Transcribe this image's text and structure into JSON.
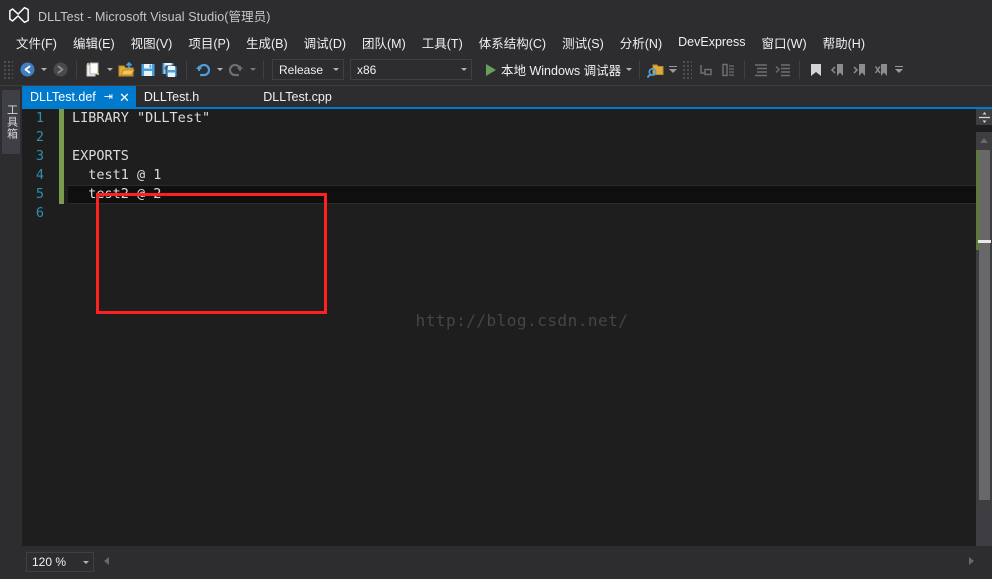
{
  "window": {
    "title": "DLLTest - Microsoft Visual Studio(管理员)",
    "logo_icon": "visual-studio-logo-icon"
  },
  "menubar": {
    "items": [
      {
        "label": "文件(F)"
      },
      {
        "label": "编辑(E)"
      },
      {
        "label": "视图(V)"
      },
      {
        "label": "项目(P)"
      },
      {
        "label": "生成(B)"
      },
      {
        "label": "调试(D)"
      },
      {
        "label": "团队(M)"
      },
      {
        "label": "工具(T)"
      },
      {
        "label": "体系结构(C)"
      },
      {
        "label": "测试(S)"
      },
      {
        "label": "分析(N)"
      },
      {
        "label": "DevExpress"
      },
      {
        "label": "窗口(W)"
      },
      {
        "label": "帮助(H)"
      }
    ]
  },
  "toolbar": {
    "navigate_back_icon": "navigate-back-icon",
    "navigate_forward_icon": "navigate-forward-icon",
    "new_project_icon": "new-project-icon",
    "open_file_icon": "open-file-icon",
    "save_icon": "save-icon",
    "save_all_icon": "save-all-icon",
    "undo_icon": "undo-icon",
    "redo_icon": "redo-icon",
    "configuration": "Release",
    "platform": "x86",
    "run_label": "本地 Windows 调试器",
    "run_play_icon": "play-icon",
    "find_in_files_icon": "find-in-files-icon",
    "step_into_icon": "step-into-icon",
    "step_over_icon": "step-over-icon",
    "indent_icon": "indent-icon",
    "outdent_icon": "outdent-icon",
    "bookmark_icon": "bookmark-icon",
    "prev_bookmark_icon": "previous-bookmark-icon",
    "next_bookmark_icon": "next-bookmark-icon",
    "clear_bookmarks_icon": "clear-bookmarks-icon",
    "overflow_icon": "toolbar-overflow-icon"
  },
  "left_dock": {
    "toolbox_label": "工具箱"
  },
  "editor": {
    "tabs": [
      {
        "label": "DLLTest.def",
        "active": true,
        "pin_icon": "pin-icon",
        "close_icon": "close-icon"
      },
      {
        "label": "DLLTest.h",
        "active": false
      },
      {
        "label": "DLLTest.cpp",
        "active": false
      }
    ],
    "lines": [
      {
        "number": "1",
        "text": "LIBRARY \"DLLTest\"",
        "changed": true
      },
      {
        "number": "2",
        "text": "",
        "changed": true
      },
      {
        "number": "3",
        "text": "EXPORTS",
        "changed": true
      },
      {
        "number": "4",
        "text": "  test1 @ 1",
        "changed": true
      },
      {
        "number": "5",
        "text": "  test2 @ 2",
        "changed": true
      },
      {
        "number": "6",
        "text": "",
        "changed": false
      }
    ],
    "current_line": 5,
    "watermark": "http://blog.csdn.net/",
    "annotation_color": "#ff2020",
    "scrollbar": {
      "split_icon": "split-view-icon",
      "up_icon": "scroll-up-icon",
      "down_icon": "scroll-down-icon"
    }
  },
  "statusbar": {
    "zoom_level": "120 %",
    "zoom_caret_icon": "chevron-down-icon",
    "hscroll_left_icon": "scroll-left-icon",
    "hscroll_right_icon": "scroll-right-icon"
  },
  "colors": {
    "accent": "#007acc",
    "chrome": "#2d2d30",
    "editor_bg": "#1e1e1e",
    "line_number": "#2b91af",
    "change_bar": "#7a9b4e",
    "annotation": "#ff2020"
  }
}
